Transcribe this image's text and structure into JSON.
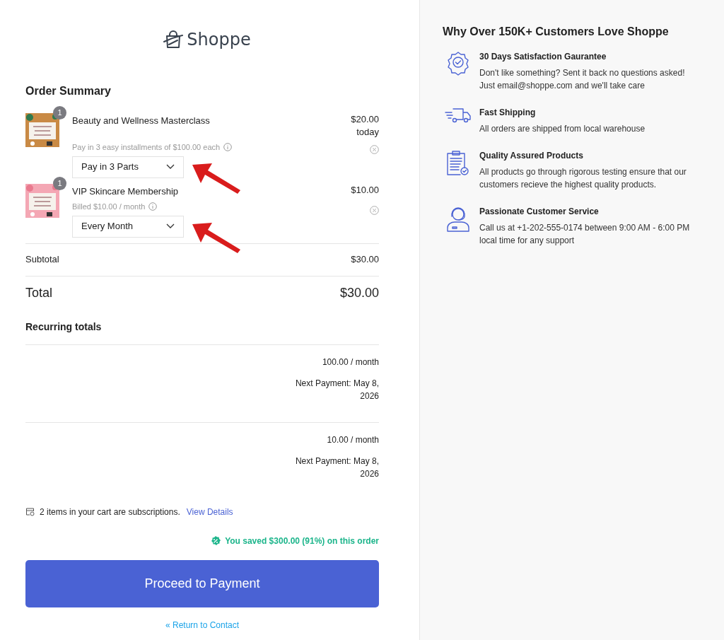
{
  "brand": {
    "name": "Shoppe"
  },
  "order_summary": {
    "title": "Order Summary",
    "items": [
      {
        "kind": "installment",
        "quantity": "1",
        "name": "Beauty and Wellness Masterclass",
        "note": "Pay in 3 easy installments of $100.00 each",
        "option": "Pay in 3 Parts",
        "price": "$20.00",
        "price_note": "today",
        "annotated": true
      },
      {
        "kind": "subscription",
        "quantity": "1",
        "name": "VIP Skincare Membership",
        "note": "Billed $10.00 / month",
        "option": "Every Month",
        "price": "$10.00",
        "annotated": true
      }
    ],
    "subtotal": {
      "label": "Subtotal",
      "value": "$30.00"
    },
    "total": {
      "label": "Total",
      "value": "$30.00"
    },
    "recurring": {
      "title": "Recurring totals",
      "rows": [
        {
          "amount": "100.00 / month",
          "next_payment": "Next Payment: May 8, 2026"
        },
        {
          "amount": "10.00 / month",
          "next_payment": "Next Payment: May 8, 2026"
        }
      ]
    },
    "subscription_note": {
      "text": "2 items in your cart are subscriptions.",
      "link": "View Details"
    },
    "savings": "You saved $300.00 (91%) on this order",
    "primary_button": "Proceed to Payment",
    "back_link": "« Return to Contact"
  },
  "benefits": {
    "title": "Why Over 150K+ Customers Love Shoppe",
    "items": [
      {
        "kind": "badge",
        "title": "30 Days Satisfaction Gaurantee",
        "text": "Don't like something? Sent it back no questions asked! Just email@shoppe.com and we'll take care"
      },
      {
        "kind": "truck",
        "title": "Fast Shipping",
        "text": "All orders are shipped from local warehouse"
      },
      {
        "kind": "clipboard",
        "title": "Quality Assured Products",
        "text": "All products go through rigorous testing ensure that our customers recieve the highest quality products."
      },
      {
        "kind": "agent",
        "title": "Passionate Customer Service",
        "text": "Call us at +1-202-555-0174 between 9:00 AM - 6:00 PM local time for any support"
      }
    ]
  }
}
